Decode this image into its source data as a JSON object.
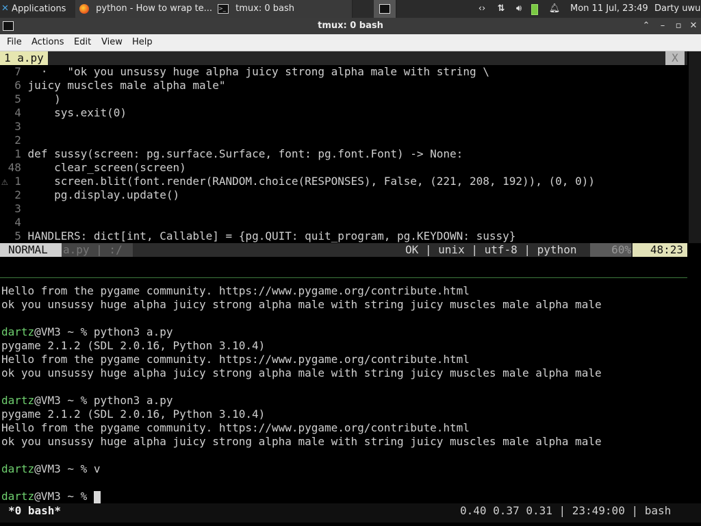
{
  "panel": {
    "applications": "Applications",
    "tasks": [
      {
        "label": "python - How to wrap te...",
        "icon": "firefox-icon"
      },
      {
        "label": "tmux: 0 bash",
        "icon": "terminal-icon"
      }
    ],
    "clock": "Mon 11 Jul, 23:49",
    "user": "Darty uwu"
  },
  "window": {
    "title": "tmux: 0 bash",
    "menus": [
      "File",
      "Actions",
      "Edit",
      "View",
      "Help"
    ]
  },
  "vim": {
    "tab_label": "1 a.py",
    "tab_close": "X",
    "lines": [
      {
        "num": "7",
        "pre": "  ",
        "code": "  ·   \"ok you unsussy huge alpha juicy strong alpha male with string \\"
      },
      {
        "num": "6",
        "pre": "  ",
        "code": "juicy muscles male alpha male\""
      },
      {
        "num": "5",
        "pre": "  ",
        "code": "    )"
      },
      {
        "num": "4",
        "pre": "  ",
        "code": "    sys.exit(0)"
      },
      {
        "num": "3",
        "pre": "  ",
        "code": ""
      },
      {
        "num": "2",
        "pre": "  ",
        "code": ""
      },
      {
        "num": "1",
        "pre": "  ",
        "code": "def sussy(screen: pg.surface.Surface, font: pg.font.Font) -> None:"
      },
      {
        "num": "48",
        "pre": " ",
        "code": "    clear_screen(screen)"
      },
      {
        "num": "1",
        "pre": "⚠ ",
        "code": "    screen.blit(font.render(RANDOM.choice(RESPONSES), False, (221, 208, 192)), (0, 0))"
      },
      {
        "num": "2",
        "pre": "  ",
        "code": "    pg.display.update()"
      },
      {
        "num": "3",
        "pre": "  ",
        "code": ""
      },
      {
        "num": "4",
        "pre": "  ",
        "code": ""
      },
      {
        "num": "5",
        "pre": "  ",
        "code": "HANDLERS: dict[int, Callable] = {pg.QUIT: quit_program, pg.KEYDOWN: sussy}"
      }
    ],
    "mode": "NORMAL",
    "file": "a.py | :/",
    "info": "OK | unix | utf-8 | python",
    "percent": "60%",
    "position": "48:23"
  },
  "shell": {
    "lines": [
      {
        "user": "",
        "text": "Hello from the pygame community. https://www.pygame.org/contribute.html"
      },
      {
        "user": "",
        "text": "ok you unsussy huge alpha juicy strong alpha male with string juicy muscles male alpha male"
      },
      {
        "user": "",
        "text": ""
      },
      {
        "user": "dartz",
        "text": "@VM3 ~ % python3 a.py"
      },
      {
        "user": "",
        "text": "pygame 2.1.2 (SDL 2.0.16, Python 3.10.4)"
      },
      {
        "user": "",
        "text": "Hello from the pygame community. https://www.pygame.org/contribute.html"
      },
      {
        "user": "",
        "text": "ok you unsussy huge alpha juicy strong alpha male with string juicy muscles male alpha male"
      },
      {
        "user": "",
        "text": ""
      },
      {
        "user": "dartz",
        "text": "@VM3 ~ % python3 a.py"
      },
      {
        "user": "",
        "text": "pygame 2.1.2 (SDL 2.0.16, Python 3.10.4)"
      },
      {
        "user": "",
        "text": "Hello from the pygame community. https://www.pygame.org/contribute.html"
      },
      {
        "user": "",
        "text": "ok you unsussy huge alpha juicy strong alpha male with string juicy muscles male alpha male"
      },
      {
        "user": "",
        "text": ""
      },
      {
        "user": "dartz",
        "text": "@VM3 ~ % v"
      },
      {
        "user": "",
        "text": ""
      },
      {
        "user": "dartz",
        "text": "@VM3 ~ % "
      }
    ]
  },
  "tmux": {
    "window": "*0 bash*",
    "status": "0.40 0.37 0.31 | 23:49:00 | bash"
  }
}
